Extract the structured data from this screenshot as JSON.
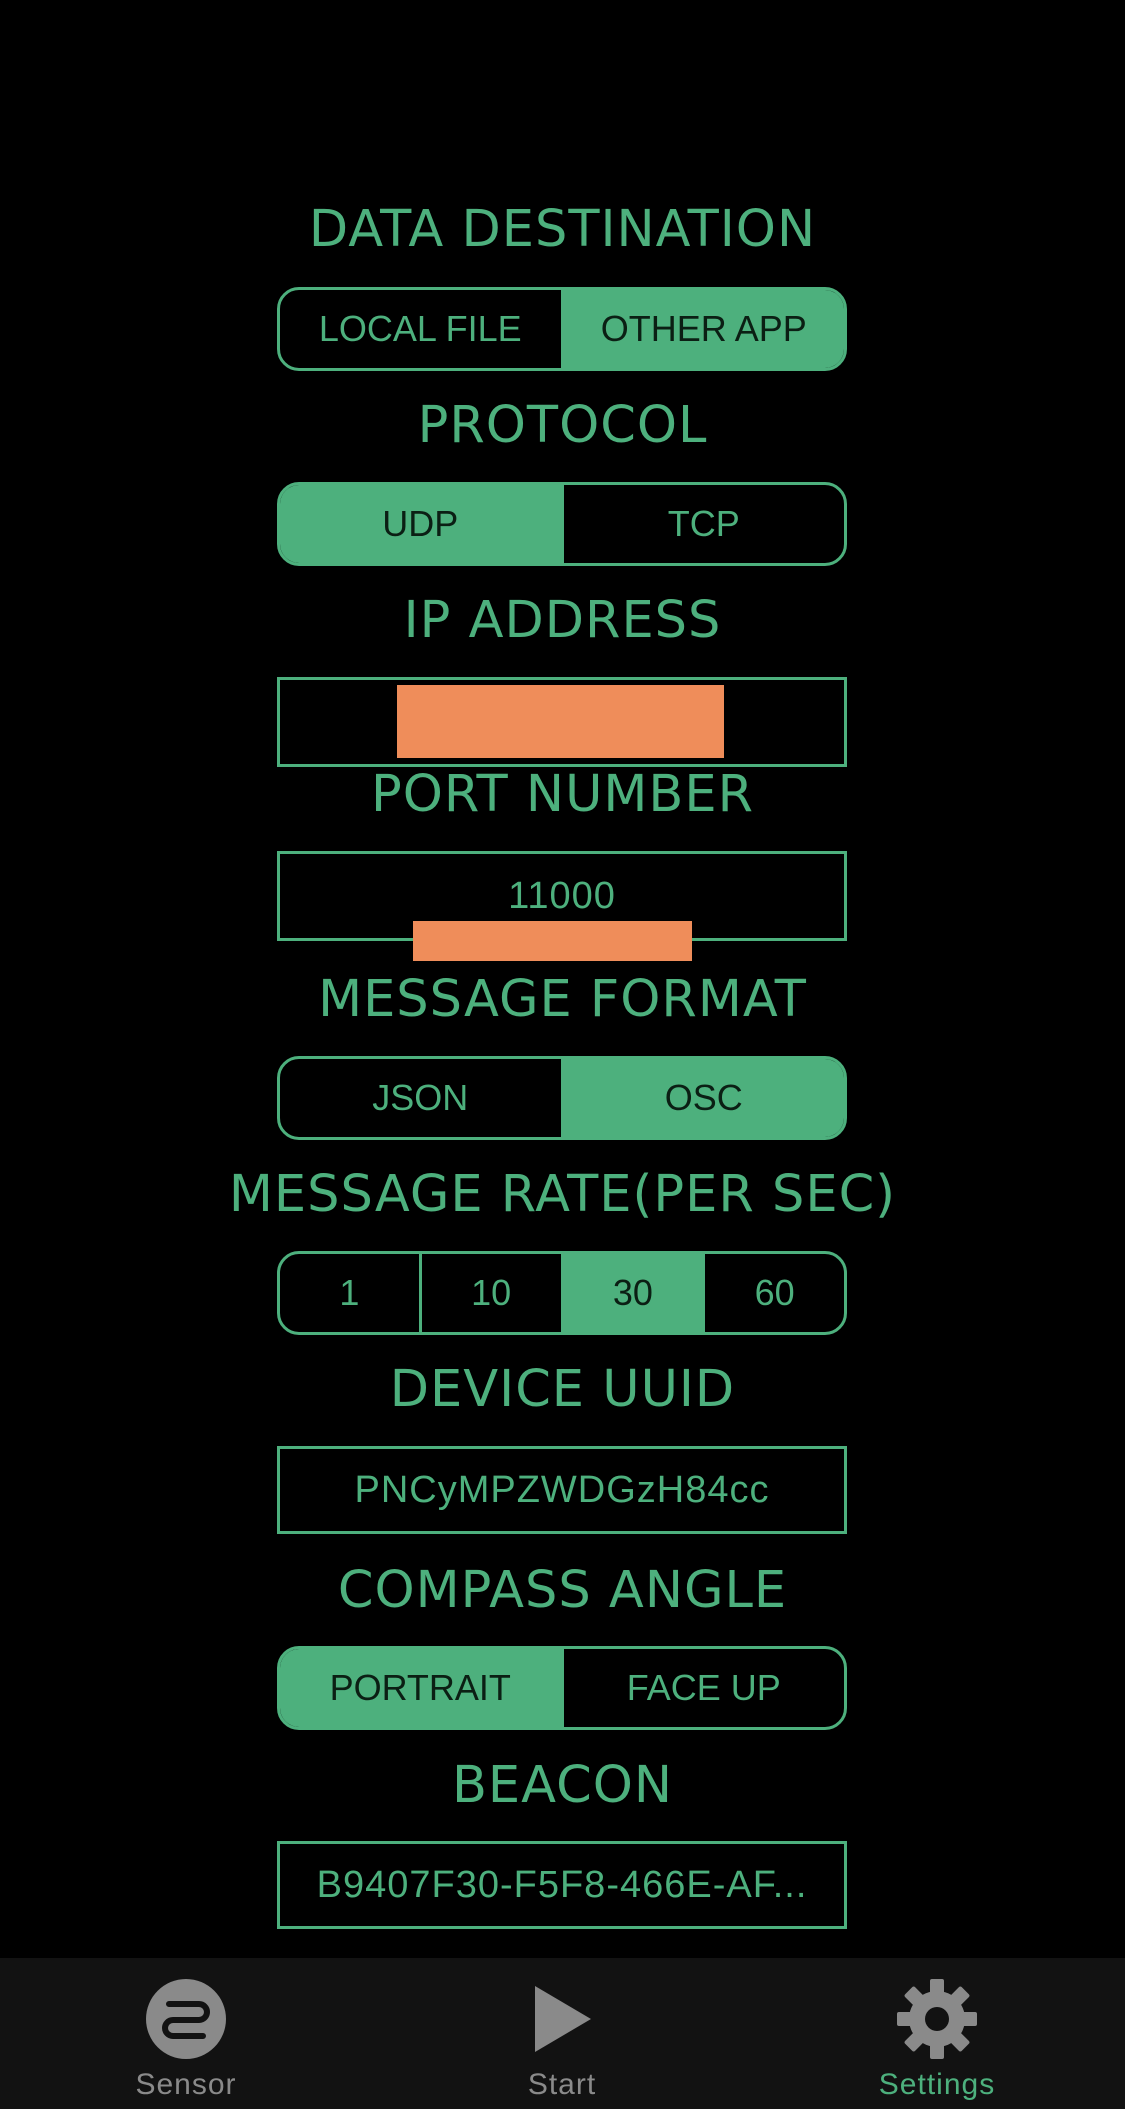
{
  "sections": {
    "data_destination": {
      "title": "DATA DESTINATION",
      "options": [
        "LOCAL FILE",
        "OTHER APP"
      ],
      "selected": "OTHER APP"
    },
    "protocol": {
      "title": "PROTOCOL",
      "options": [
        "UDP",
        "TCP"
      ],
      "selected": "UDP"
    },
    "ip_address": {
      "title": "IP ADDRESS",
      "value": ""
    },
    "port_number": {
      "title": "PORT NUMBER",
      "value": "11000"
    },
    "message_format": {
      "title": "MESSAGE FORMAT",
      "options": [
        "JSON",
        "OSC"
      ],
      "selected": "OSC"
    },
    "message_rate": {
      "title": "MESSAGE RATE(PER SEC)",
      "options": [
        "1",
        "10",
        "30",
        "60"
      ],
      "selected": "30"
    },
    "device_uuid": {
      "title": "DEVICE UUID",
      "value": "PNCyMPZWDGzH84cc"
    },
    "compass_angle": {
      "title": "COMPASS ANGLE",
      "options": [
        "PORTRAIT",
        "FACE UP"
      ],
      "selected": "PORTRAIT"
    },
    "beacon": {
      "title": "BEACON",
      "value": "B9407F30-F5F8-466E-AF..."
    }
  },
  "tabbar": {
    "items": [
      {
        "label": "Sensor",
        "icon": "sensor-icon",
        "active": false
      },
      {
        "label": "Start",
        "icon": "play-icon",
        "active": false
      },
      {
        "label": "Settings",
        "icon": "gear-icon",
        "active": true
      }
    ]
  },
  "colors": {
    "accent": "#4db07d",
    "background": "#000000",
    "tabbar_background": "#121212",
    "inactive_tab": "#8a8a8a",
    "redaction": "#ef8d5a"
  }
}
